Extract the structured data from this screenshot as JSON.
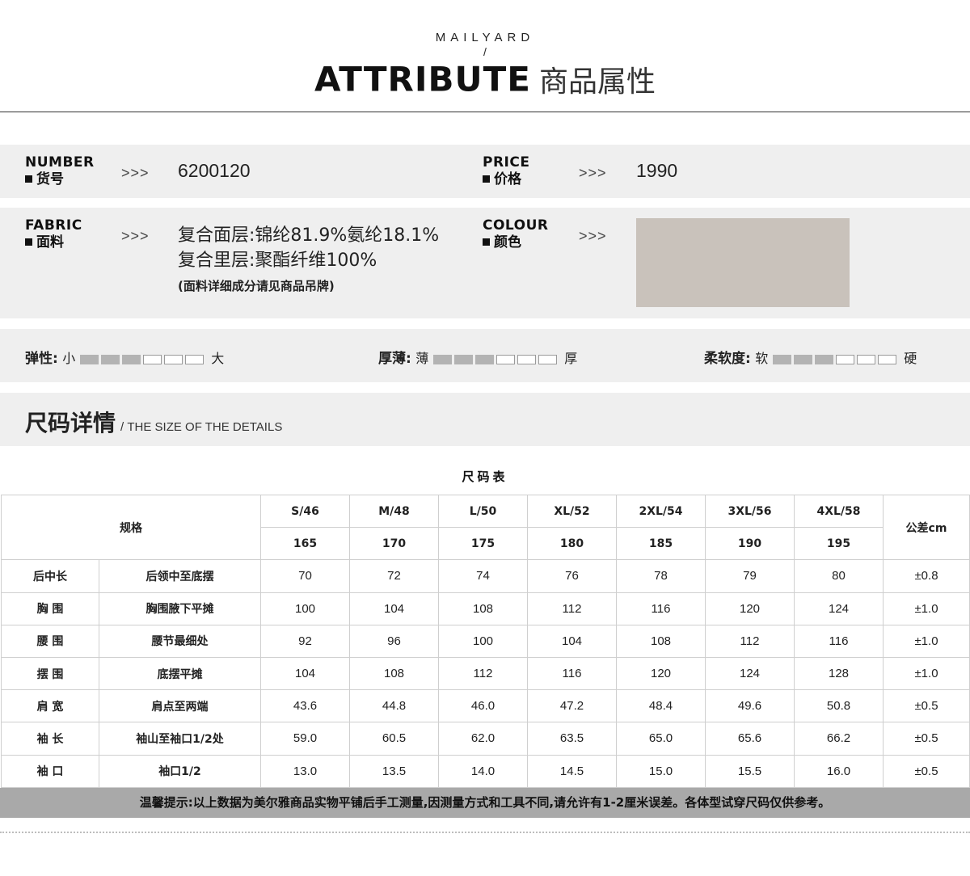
{
  "header": {
    "brand": "MAILYARD",
    "slash": "/",
    "title_en": "ATTRIBUTE",
    "title_cn": "商品属性"
  },
  "info": {
    "arrows": ">>>",
    "number": {
      "en": "NUMBER",
      "cn": "货号",
      "value": "6200120"
    },
    "price": {
      "en": "PRICE",
      "cn": "价格",
      "value": "1990"
    },
    "fabric": {
      "en": "FABRIC",
      "cn": "面料",
      "line1": "复合面层:锦纶81.9%氨纶18.1%",
      "line2": "复合里层:聚酯纤维100%",
      "note": "(面料详细成分请见商品吊牌)"
    },
    "colour": {
      "en": "COLOUR",
      "cn": "颜色",
      "swatch_color": "#c9c2bb"
    }
  },
  "scales": [
    {
      "name": "弹性:",
      "low": "小",
      "high": "大",
      "level": 3,
      "total": 6
    },
    {
      "name": "厚薄:",
      "low": "薄",
      "high": "厚",
      "level": 3,
      "total": 6
    },
    {
      "name": "柔软度:",
      "low": "软",
      "high": "硬",
      "level": 3,
      "total": 6
    }
  ],
  "size_section": {
    "title_cn": "尺码详情",
    "title_en": "/ THE SIZE OF THE DETAILS"
  },
  "size_table": {
    "caption": "尺码表",
    "spec_label": "规格",
    "tolerance_label": "公差cm",
    "sizes": [
      "S/46",
      "M/48",
      "L/50",
      "XL/52",
      "2XL/54",
      "3XL/56",
      "4XL/58"
    ],
    "heights": [
      "165",
      "170",
      "175",
      "180",
      "185",
      "190",
      "195"
    ],
    "rows": [
      {
        "part": "后中长",
        "method": "后领中至底摆",
        "values": [
          "70",
          "72",
          "74",
          "76",
          "78",
          "79",
          "80"
        ],
        "tol": "±0.8"
      },
      {
        "part": "胸 围",
        "method": "胸围腋下平摊",
        "values": [
          "100",
          "104",
          "108",
          "112",
          "116",
          "120",
          "124"
        ],
        "tol": "±1.0"
      },
      {
        "part": "腰 围",
        "method": "腰节最细处",
        "values": [
          "92",
          "96",
          "100",
          "104",
          "108",
          "112",
          "116"
        ],
        "tol": "±1.0"
      },
      {
        "part": "摆 围",
        "method": "底摆平摊",
        "values": [
          "104",
          "108",
          "112",
          "116",
          "120",
          "124",
          "128"
        ],
        "tol": "±1.0"
      },
      {
        "part": "肩 宽",
        "method": "肩点至两端",
        "values": [
          "43.6",
          "44.8",
          "46.0",
          "47.2",
          "48.4",
          "49.6",
          "50.8"
        ],
        "tol": "±0.5"
      },
      {
        "part": "袖 长",
        "method": "袖山至袖口1/2处",
        "values": [
          "59.0",
          "60.5",
          "62.0",
          "63.5",
          "65.0",
          "65.6",
          "66.2"
        ],
        "tol": "±0.5"
      },
      {
        "part": "袖 口",
        "method": "袖口1/2",
        "values": [
          "13.0",
          "13.5",
          "14.0",
          "14.5",
          "15.0",
          "15.5",
          "16.0"
        ],
        "tol": "±0.5"
      }
    ]
  },
  "tip": "温馨提示:以上数据为美尔雅商品实物平铺后手工测量,因测量方式和工具不同,请允许有1-2厘米误差。各体型试穿尺码仅供参考。"
}
